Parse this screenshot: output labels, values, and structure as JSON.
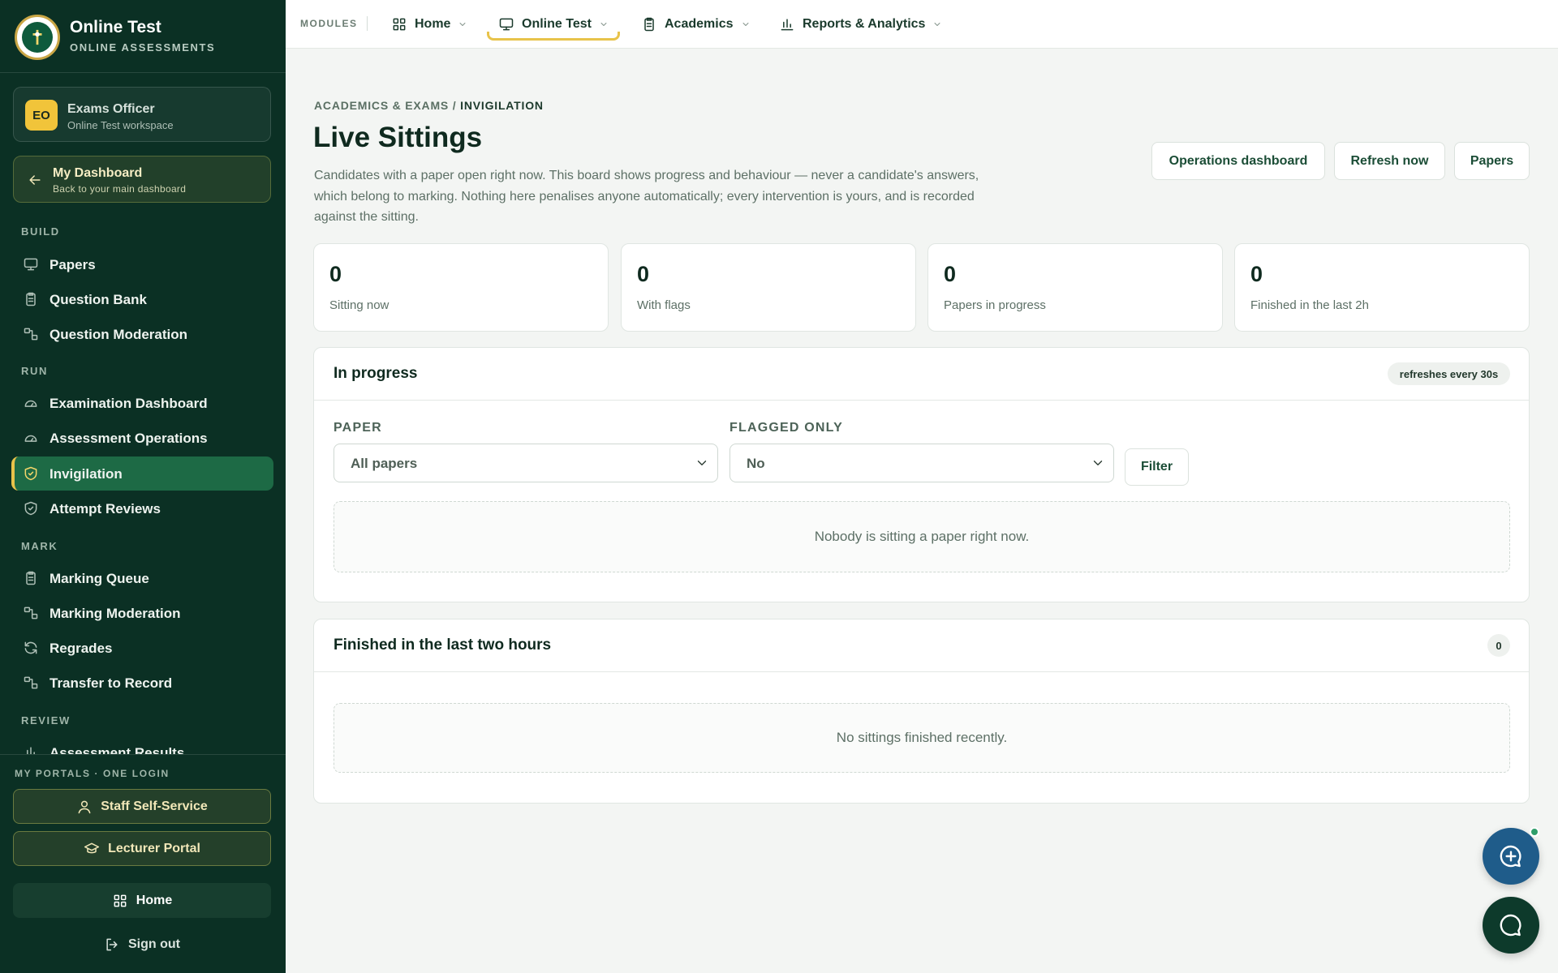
{
  "app": {
    "title": "Online Test",
    "subtitle": "ONLINE ASSESSMENTS",
    "logo_icon": "crest-icon"
  },
  "user": {
    "initials": "EO",
    "name": "Exams Officer",
    "workspace": "Online Test workspace"
  },
  "dashboard_link": {
    "label": "My Dashboard",
    "sub": "Back to your main dashboard"
  },
  "sidebar": {
    "sections": [
      {
        "label": "BUILD",
        "items": [
          {
            "label": "Papers",
            "icon": "monitor-icon"
          },
          {
            "label": "Question Bank",
            "icon": "clipboard-icon"
          },
          {
            "label": "Question Moderation",
            "icon": "workflow-icon"
          }
        ]
      },
      {
        "label": "RUN",
        "items": [
          {
            "label": "Examination Dashboard",
            "icon": "gauge-icon"
          },
          {
            "label": "Assessment Operations",
            "icon": "gauge-icon"
          },
          {
            "label": "Invigilation",
            "icon": "shield-check-icon",
            "active": true
          },
          {
            "label": "Attempt Reviews",
            "icon": "shield-check-icon"
          }
        ]
      },
      {
        "label": "MARK",
        "items": [
          {
            "label": "Marking Queue",
            "icon": "clipboard-icon"
          },
          {
            "label": "Marking Moderation",
            "icon": "workflow-icon"
          },
          {
            "label": "Regrades",
            "icon": "refresh-icon"
          },
          {
            "label": "Transfer to Record",
            "icon": "workflow-icon"
          }
        ]
      },
      {
        "label": "REVIEW",
        "items": [
          {
            "label": "Assessment Results",
            "icon": "bar-chart-icon"
          }
        ]
      }
    ]
  },
  "portals": {
    "heading": "MY PORTALS · ONE LOGIN",
    "staff": "Staff Self-Service",
    "lecturer": "Lecturer Portal",
    "home": "Home",
    "signout": "Sign out"
  },
  "topbar": {
    "modules_label": "MODULES",
    "menus": [
      {
        "label": "Home",
        "icon": "grid-icon"
      },
      {
        "label": "Online Test",
        "icon": "monitor-icon",
        "active": true
      },
      {
        "label": "Academics",
        "icon": "clipboard-icon"
      },
      {
        "label": "Reports & Analytics",
        "icon": "bar-chart-icon"
      }
    ]
  },
  "page": {
    "breadcrumb_parent": "ACADEMICS & EXAMS",
    "breadcrumb_sep": " / ",
    "breadcrumb_current": "INVIGILATION",
    "title": "Live Sittings",
    "description": "Candidates with a paper open right now. This board shows progress and behaviour — never a candidate's answers, which belong to marking. Nothing here penalises anyone automatically; every intervention is yours, and is recorded against the sitting.",
    "buttons": {
      "ops": "Operations dashboard",
      "refresh": "Refresh now",
      "papers": "Papers"
    }
  },
  "stats": [
    {
      "value": "0",
      "label": "Sitting now"
    },
    {
      "value": "0",
      "label": "With flags"
    },
    {
      "value": "0",
      "label": "Papers in progress"
    },
    {
      "value": "0",
      "label": "Finished in the last 2h"
    }
  ],
  "in_progress": {
    "title": "In progress",
    "badge": "refreshes every 30s",
    "paper_label": "PAPER",
    "paper_value": "All papers",
    "flagged_label": "FLAGGED ONLY",
    "flagged_value": "No",
    "filter_button": "Filter",
    "empty": "Nobody is sitting a paper right now."
  },
  "finished": {
    "title": "Finished in the last two hours",
    "count": "0",
    "empty": "No sittings finished recently."
  },
  "colors": {
    "sidebar": "#0b3024",
    "accent": "#e8c34a",
    "active_item": "#1d6a45",
    "fab_blue": "#1f5c8a",
    "fab_green": "#0d3a2b"
  }
}
